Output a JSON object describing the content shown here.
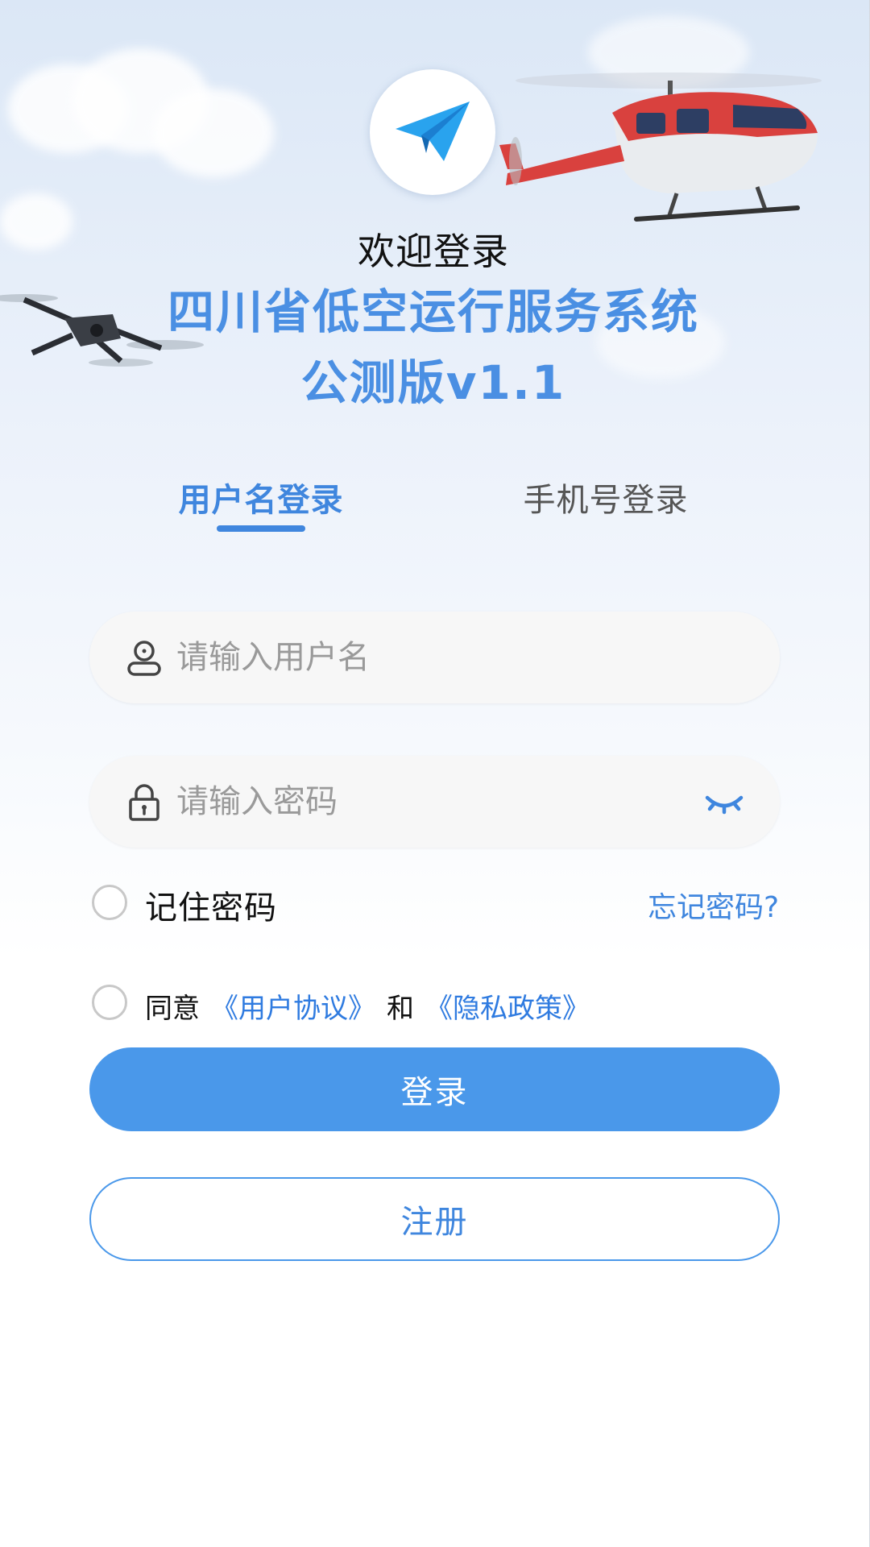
{
  "header": {
    "welcome": "欢迎登录",
    "title_line1": "四川省低空运行服务系统",
    "title_line2": "公测版v1.1",
    "logo_icon": "paper-plane-icon"
  },
  "tabs": [
    {
      "label": "用户名登录",
      "active": true
    },
    {
      "label": "手机号登录",
      "active": false
    }
  ],
  "form": {
    "username_placeholder": "请输入用户名",
    "username_value": "",
    "password_placeholder": "请输入密码",
    "password_value": "",
    "remember_label": "记住密码",
    "remember_checked": false,
    "forgot_label": "忘记密码?",
    "agree_prefix": "同意",
    "agree_link1": "《用户协议》",
    "agree_and": "和",
    "agree_link2": "《隐私政策》",
    "agree_checked": false
  },
  "buttons": {
    "login": "登录",
    "register": "注册"
  },
  "colors": {
    "accent": "#4a98ea",
    "title": "#4a8fe3",
    "link": "#2f7be0"
  },
  "decorations": [
    "helicopter-illustration",
    "drone-illustration",
    "cloud-illustration"
  ]
}
